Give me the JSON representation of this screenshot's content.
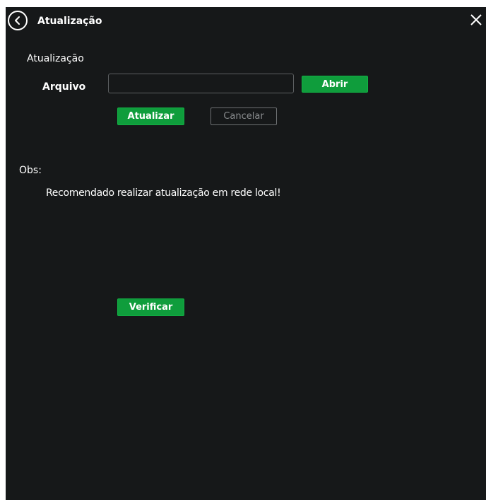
{
  "header": {
    "title": "Atualização",
    "back_icon": "chevron-left-circle-icon",
    "close_icon": "close-icon"
  },
  "update": {
    "section_title": "Atualização",
    "file_label": "Arquivo",
    "file_value": "",
    "open_label": "Abrir",
    "update_label": "Atualizar",
    "cancel_label": "Cancelar"
  },
  "notes": {
    "label": "Obs:",
    "text": "Recomendado realizar atualização em rede local!"
  },
  "check": {
    "label": "Verificar"
  },
  "colors": {
    "background": "#161819",
    "accent_green": "#0f9d3c",
    "text": "#ffffff"
  }
}
